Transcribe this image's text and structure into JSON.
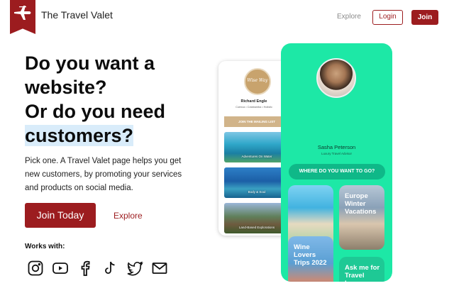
{
  "header": {
    "brand": "The Travel Valet",
    "explore": "Explore",
    "login": "Login",
    "join": "Join"
  },
  "hero": {
    "title_line1": "Do you want a",
    "title_line2": "website?",
    "title_line3": "Or do you need",
    "title_line4": "customers?",
    "description": "Pick one. A Travel Valet page helps you get new customers, by promoting your services and products on social media.",
    "cta": "Join Today",
    "explore": "Explore",
    "works_with": "Works with:"
  },
  "social_icons": [
    "instagram-icon",
    "youtube-icon",
    "facebook-icon",
    "tiktok-icon",
    "twitter-icon",
    "email-icon"
  ],
  "phone_left": {
    "name": "Richard Engle",
    "subtitle": "Cuenca • Cotabamba • Holistic",
    "mailing_list": "JOIN THE MAILING LIST",
    "cards": [
      "Adventures On Water",
      "Body & Soul",
      "Land-Based Explorations"
    ]
  },
  "phone_right": {
    "name": "Sasha Peterson",
    "subtitle": "Luxury Travel Advisor",
    "where": "WHERE DO YOU WANT TO GO?",
    "tiles": [
      "",
      "Europe Winter Vacations",
      "Wine Lovers Trips 2022",
      "Ask me for Travel Insurance"
    ]
  },
  "colors": {
    "brand_red": "#9c1c1f",
    "mint": "#1de8a6",
    "highlight": "#d9ecfa"
  }
}
